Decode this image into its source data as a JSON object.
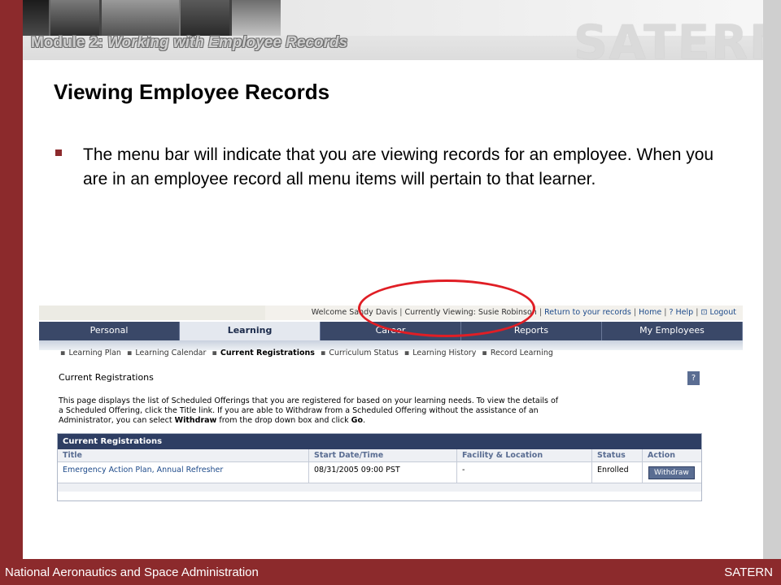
{
  "header": {
    "module_prefix": "Module 2: ",
    "module_italic": "Working with Employee Records",
    "logo": "SATERN"
  },
  "slide": {
    "title": "Viewing Employee Records",
    "bullet": "The menu bar will indicate that you are viewing records for an employee.  When you are in an employee record all menu items will pertain to that learner."
  },
  "footer": {
    "left": "National Aeronautics and Space Administration",
    "right": "SATERN"
  },
  "screenshot": {
    "topbar": {
      "welcome": "Welcome Sandy Davis",
      "viewing": "Currently Viewing: Susie Robinson",
      "return_link": "Return to your records",
      "home_link": "Home",
      "help_link": "? Help",
      "logout_link": "Logout"
    },
    "nav": [
      {
        "label": "Personal",
        "active": false
      },
      {
        "label": "Learning",
        "active": true
      },
      {
        "label": "Career",
        "active": false
      },
      {
        "label": "Reports",
        "active": false
      },
      {
        "label": "My Employees",
        "active": false
      }
    ],
    "subnav": [
      {
        "label": "Learning Plan",
        "current": false
      },
      {
        "label": "Learning Calendar",
        "current": false
      },
      {
        "label": "Current Registrations",
        "current": true
      },
      {
        "label": "Curriculum Status",
        "current": false
      },
      {
        "label": "Learning History",
        "current": false
      },
      {
        "label": "Record Learning",
        "current": false
      }
    ],
    "page_heading": "Current Registrations",
    "help_button": "?",
    "description": {
      "part1": "This page displays the list of Scheduled Offerings that you are registered for based on your learning needs. To view the details of a Scheduled Offering, click the Title link. If you are able to Withdraw from a Scheduled Offering without the assistance of an Administrator, you can select ",
      "bold1": "Withdraw",
      "part2": " from the drop down box and click ",
      "bold2": "Go",
      "part3": "."
    },
    "table": {
      "caption": "Current Registrations",
      "columns": [
        "Title",
        "Start Date/Time",
        "Facility & Location",
        "Status",
        "Action"
      ],
      "rows": [
        {
          "title": "Emergency Action Plan, Annual Refresher",
          "start": "08/31/2005 09:00 PST",
          "facility": "-",
          "status": "Enrolled",
          "action": "Withdraw"
        }
      ]
    }
  },
  "colors": {
    "frame_maroon": "#8c2a2c",
    "nav_navy": "#3a4868",
    "annotation_red": "#e01e25"
  }
}
